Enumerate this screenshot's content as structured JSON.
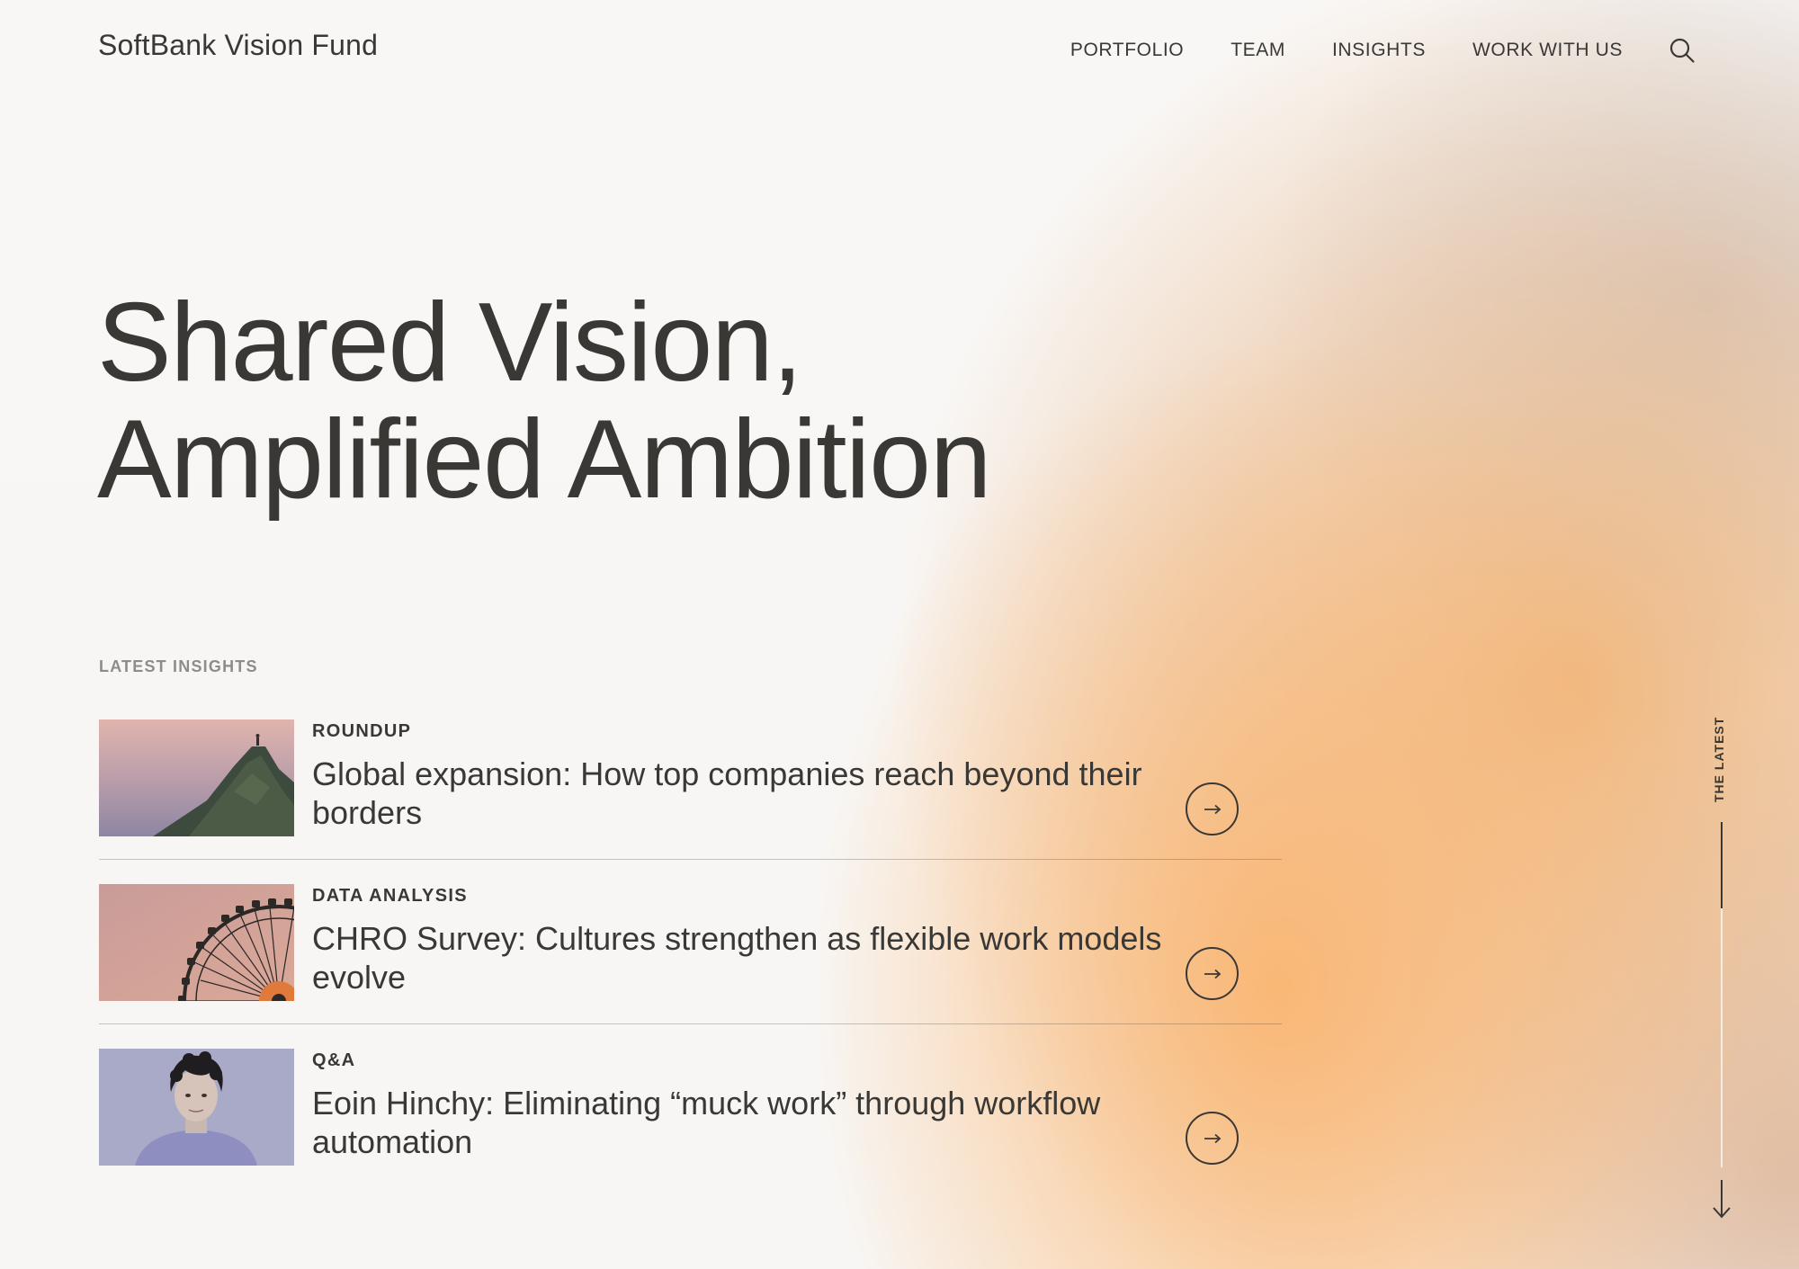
{
  "header": {
    "logo": "SoftBank Vision Fund",
    "nav": [
      "PORTFOLIO",
      "TEAM",
      "INSIGHTS",
      "WORK WITH US"
    ],
    "search_icon": "search-icon"
  },
  "hero": {
    "line1": "Shared Vision,",
    "line2": "Amplified Ambition"
  },
  "insights": {
    "label": "LATEST INSIGHTS",
    "items": [
      {
        "category": "ROUNDUP",
        "title": "Global expansion: How top companies reach beyond their borders",
        "image": "hiker-on-mountain-ridge-photo"
      },
      {
        "category": "DATA ANALYSIS",
        "title": "CHRO Survey: Cultures strengthen as flexible work models evolve",
        "image": "ferris-wheel-photo"
      },
      {
        "category": "Q&A",
        "title": "Eoin Hinchy: Eliminating “muck work” through workflow automation",
        "image": "portrait-photo"
      }
    ],
    "arrow_icon": "arrow-right-icon"
  },
  "rail": {
    "label": "THE LATEST",
    "progress": 0.25,
    "arrow_icon": "arrow-down-icon"
  },
  "colors": {
    "text": "#3a3835",
    "muted": "#8f8b87",
    "accent_orange": "#f9b672",
    "background": "#f8f6f4"
  }
}
